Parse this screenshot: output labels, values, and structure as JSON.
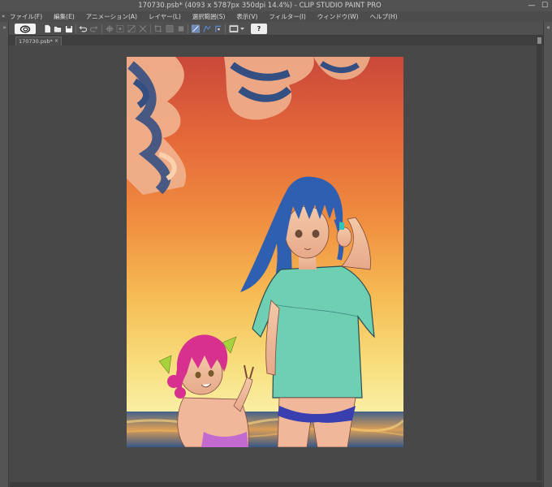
{
  "titlebar": {
    "title": "170730.psb* (4093 x 5787px 350dpi 14.4%)  - CLIP STUDIO PAINT PRO",
    "minimize_glyph": "—",
    "maximize_glyph": "☐"
  },
  "menubar": {
    "collapse_glyph": "«",
    "items": [
      {
        "label": "ファイル(F)"
      },
      {
        "label": "編集(E)"
      },
      {
        "label": "アニメーション(A)"
      },
      {
        "label": "レイヤー(L)"
      },
      {
        "label": "選択範囲(S)"
      },
      {
        "label": "表示(V)"
      },
      {
        "label": "フィルター(I)"
      },
      {
        "label": "ウィンドウ(W)"
      },
      {
        "label": "ヘルプ(H)"
      }
    ]
  },
  "toolbar": {
    "help_label": "?",
    "icons": [
      "clip-studio-logo-icon",
      "new-file-icon",
      "open-file-icon",
      "save-icon",
      "undo-icon",
      "redo-icon",
      "transform-icon",
      "scale-icon",
      "deselect-icon",
      "invert-selection-icon",
      "crop-icon",
      "clear-icon",
      "fill-icon",
      "snap-ruler-icon",
      "snap-grid-icon",
      "snap-special-icon",
      "canvas-view-icon",
      "help-icon"
    ]
  },
  "document": {
    "tab_label": "170730.psb*",
    "tab_close_glyph": "×"
  },
  "colors": {
    "window_bg": "#484848",
    "titlebar_bg": "#525252",
    "sky_top": "#c9483a",
    "sky_bottom": "#faf0a8",
    "hair_blue": "#2f5fb0",
    "shirt_teal": "#6fcfb3",
    "hair_pink": "#d8308f",
    "bow_green": "#a7d23e"
  }
}
